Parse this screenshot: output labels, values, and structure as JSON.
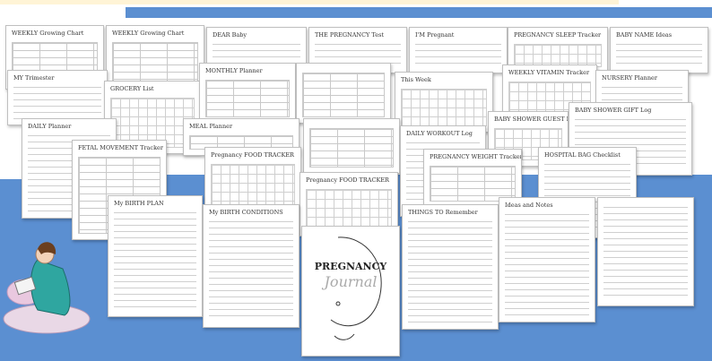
{
  "sheets": {
    "s1": "WEEKLY Growing Chart",
    "s2": "WEEKLY Growing Chart",
    "s3": "DEAR Baby",
    "s4": "THE PREGNANCY Test",
    "s5": "I'M Pregnant",
    "s6": "PREGNANCY SLEEP Tracker",
    "s7": "BABY NAME Ideas",
    "s8": "MY Trimester",
    "s9": "GROCERY List",
    "s10": "MONTHLY Planner",
    "s11": "This Week",
    "s12": "WEEKLY VITAMIN Tracker",
    "s13": "NURSERY Planner",
    "s14": "DAILY Planner",
    "s15": "MEAL Planner",
    "s16": "BABY SHOWER GUEST List",
    "s17": "BABY SHOWER GIFT Log",
    "s18": "FETAL MOVEMENT Tracker",
    "s19": "Pregnancy FOOD TRACKER",
    "s20": "DAILY WORKOUT Log",
    "s21": "PREGNANCY WEIGHT Tracker",
    "s22": "HOSPITAL BAG Checklist",
    "s23": "Pregnancy FOOD TRACKER",
    "s24": "My BIRTH PLAN",
    "s25": "My BIRTH CONDITIONS",
    "s26": "THINGS TO Remember",
    "s27": "Ideas and Notes"
  },
  "cover": {
    "title": "PREGNANCY",
    "subtitle": "Journal"
  },
  "colors": {
    "blue": "#5b8fd1",
    "cream": "#fff4d6",
    "teal": "#2fa6a0"
  },
  "icons": {
    "mother": "pregnant-woman-illustration"
  }
}
